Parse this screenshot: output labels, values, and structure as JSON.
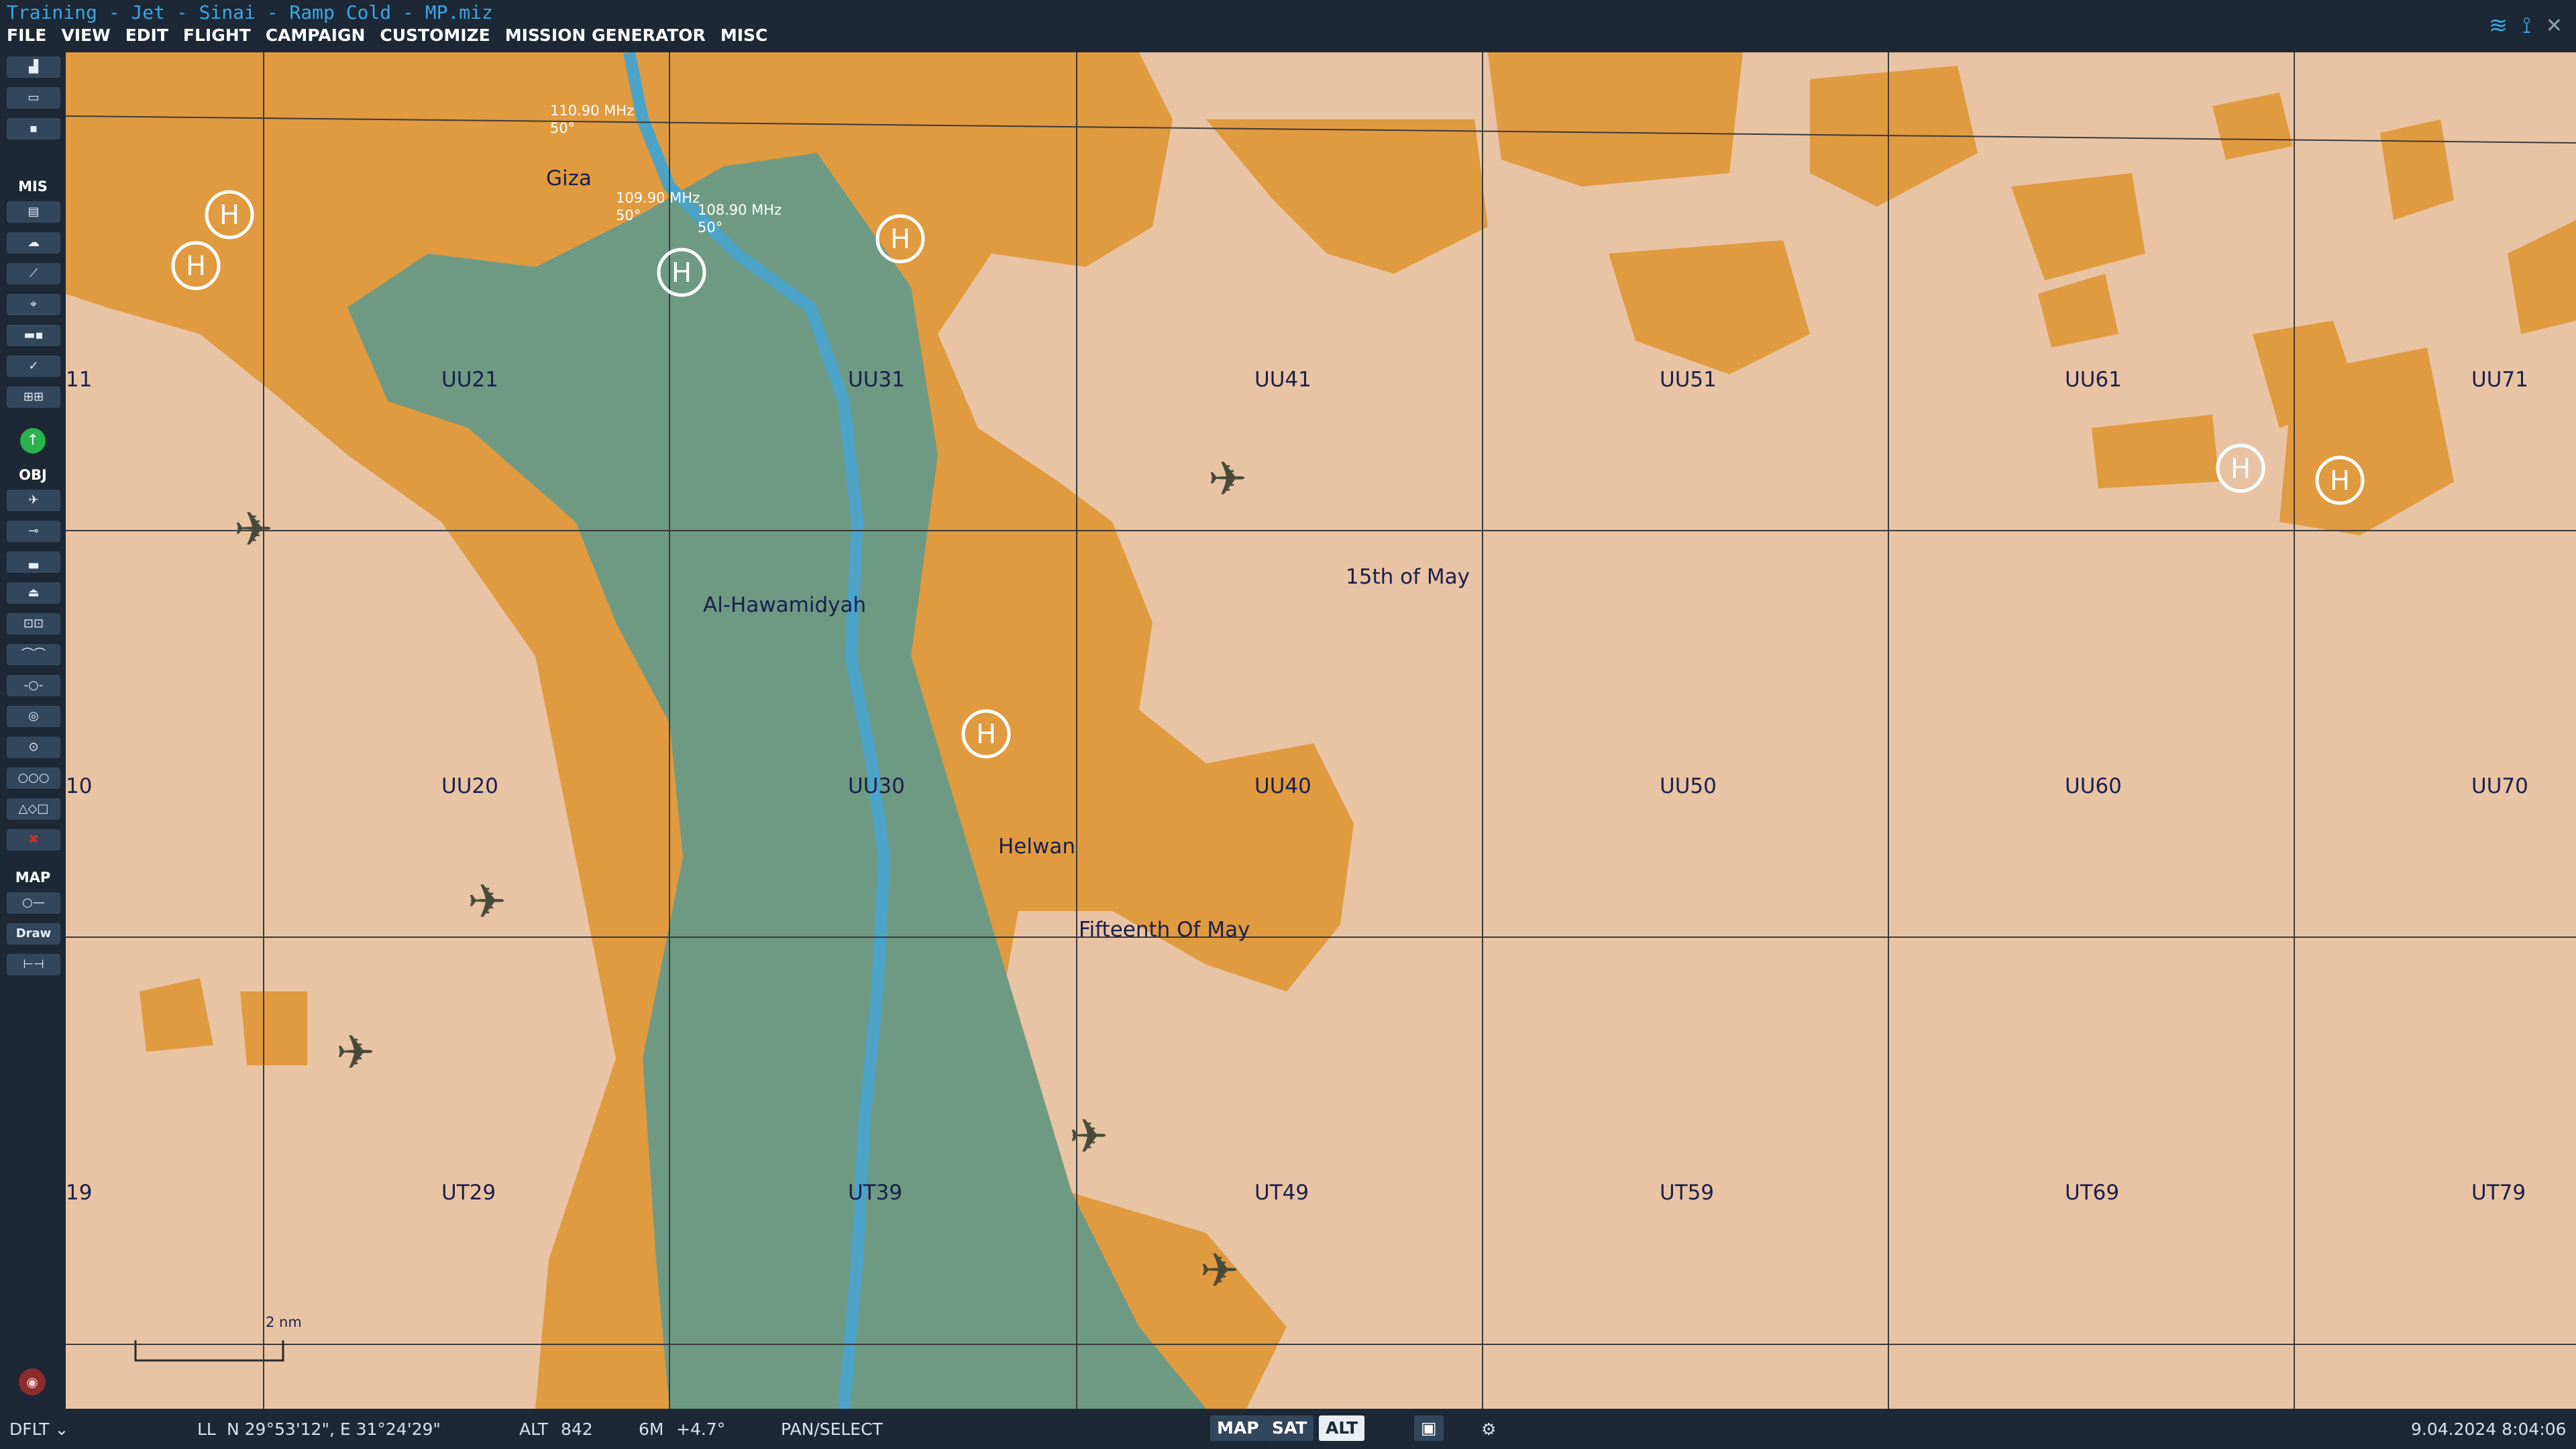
{
  "window": {
    "title": "Training - Jet - Sinai - Ramp Cold - MP.miz",
    "wifi_icon": "wifi-icon",
    "antenna_icon": "antenna-icon",
    "close_icon": "close-icon"
  },
  "menu": [
    "FILE",
    "VIEW",
    "EDIT",
    "FLIGHT",
    "CAMPAIGN",
    "CUSTOMIZE",
    "MISSION GENERATOR",
    "MISC"
  ],
  "sidebar": {
    "section_mis": "MIS",
    "section_obj": "OBJ",
    "section_map": "MAP",
    "draw_label": "Draw",
    "colors": {
      "bg": "#1c2835",
      "button": "#33475c",
      "add_green": "#2bb24c",
      "delete_red": "#d43030"
    }
  },
  "map": {
    "colors": {
      "desert": "#e8c4a4",
      "urban": "#e09a3f",
      "vegetation": "#6e9a83",
      "river": "#4ba3c8",
      "grid": "#3a3a3a"
    },
    "cities": [
      "Giza",
      "Al-Hawamidyah",
      "15th of May",
      "Helwan",
      "Fifteenth Of May"
    ],
    "grid_row1": [
      "11",
      "UU21",
      "UU31",
      "UU41",
      "UU51",
      "UU61",
      "UU71"
    ],
    "grid_row2": [
      "10",
      "UU20",
      "UU30",
      "UU40",
      "UU50",
      "UU60",
      "UU70"
    ],
    "grid_row3": [
      "19",
      "UT29",
      "UT39",
      "UT49",
      "UT59",
      "UT69",
      "UT79"
    ],
    "frequencies": [
      {
        "freq": "110.90 MHz",
        "course": "50°"
      },
      {
        "freq": "109.90 MHz",
        "course": "50°"
      },
      {
        "freq": "108.90 MHz",
        "course": "50°"
      }
    ],
    "scale_label": "2 nm"
  },
  "status": {
    "profile": "DFLT",
    "coord_mode": "LL",
    "coordinates": "N 29°53'12\", E 31°24'29\"",
    "alt_label": "ALT",
    "alt_value": "842",
    "magvar_label": "6M",
    "magvar_value": "+4.7°",
    "mode": "PAN/SELECT",
    "map_btn": "MAP",
    "sat_btn": "SAT",
    "alt_btn": "ALT",
    "datetime": "9.04.2024 8:04:06"
  }
}
